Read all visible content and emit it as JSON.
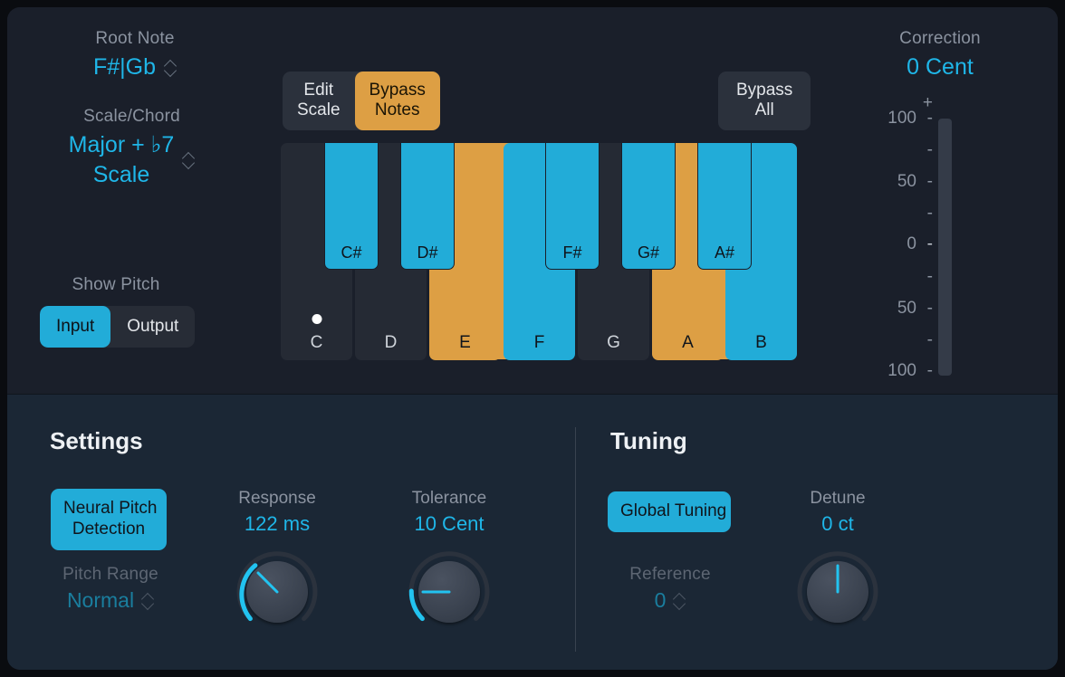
{
  "root_note": {
    "label": "Root Note",
    "value": "F#|Gb",
    "chevron_icon": "chevron-updown-icon"
  },
  "scale_chord": {
    "label": "Scale/Chord",
    "value_line1": "Major + ♭7",
    "value_line2": "Scale",
    "chevron_icon": "chevron-updown-icon"
  },
  "show_pitch": {
    "label": "Show Pitch",
    "options": [
      {
        "label": "Input",
        "selected": true
      },
      {
        "label": "Output",
        "selected": false
      }
    ]
  },
  "scale_mode": {
    "options": [
      {
        "line1": "Edit",
        "line2": "Scale",
        "selected": false
      },
      {
        "line1": "Bypass",
        "line2": "Notes",
        "selected": true
      }
    ]
  },
  "bypass_all": {
    "line1": "Bypass",
    "line2": "All"
  },
  "keyboard": {
    "white_keys": [
      {
        "name": "C",
        "state": "off",
        "indicator": true
      },
      {
        "name": "D",
        "state": "off",
        "indicator": false
      },
      {
        "name": "E",
        "state": "orange",
        "indicator": false
      },
      {
        "name": "F",
        "state": "blue",
        "indicator": false
      },
      {
        "name": "G",
        "state": "off",
        "indicator": false
      },
      {
        "name": "A",
        "state": "orange",
        "indicator": false
      },
      {
        "name": "B",
        "state": "blue",
        "indicator": false
      }
    ],
    "black_keys": [
      {
        "name": "C#",
        "state": "blue"
      },
      {
        "name": "D#",
        "state": "blue"
      },
      {
        "name": "F#",
        "state": "blue"
      },
      {
        "name": "G#",
        "state": "blue"
      },
      {
        "name": "A#",
        "state": "blue"
      }
    ]
  },
  "correction": {
    "label": "Correction",
    "value": "0 Cent",
    "scale_top_sign": "+",
    "ticks": [
      "100",
      "",
      "50",
      "",
      "0",
      "",
      "50",
      "",
      "100",
      ""
    ]
  },
  "settings": {
    "title": "Settings",
    "neural_pitch": {
      "line1": "Neural Pitch",
      "line2": "Detection",
      "active": true
    },
    "pitch_range": {
      "label": "Pitch Range",
      "value": "Normal",
      "disabled": true,
      "chevron_icon": "chevron-updown-icon"
    },
    "response": {
      "label": "Response",
      "value": "122 ms"
    },
    "tolerance": {
      "label": "Tolerance",
      "value": "10 Cent"
    }
  },
  "tuning": {
    "title": "Tuning",
    "global_tuning": {
      "label": "Global Tuning",
      "active": true
    },
    "reference": {
      "label": "Reference",
      "value": "0",
      "disabled": true,
      "chevron_icon": "chevron-updown-icon"
    },
    "detune": {
      "label": "Detune",
      "value": "0 ct"
    }
  },
  "colors": {
    "accent_blue": "#22acd8",
    "accent_orange": "#dd9f44",
    "value_blue": "#1fb6e8",
    "panel_top": "#1a1f2a",
    "panel_bottom": "#1b2735",
    "key_off": "#252a34"
  }
}
